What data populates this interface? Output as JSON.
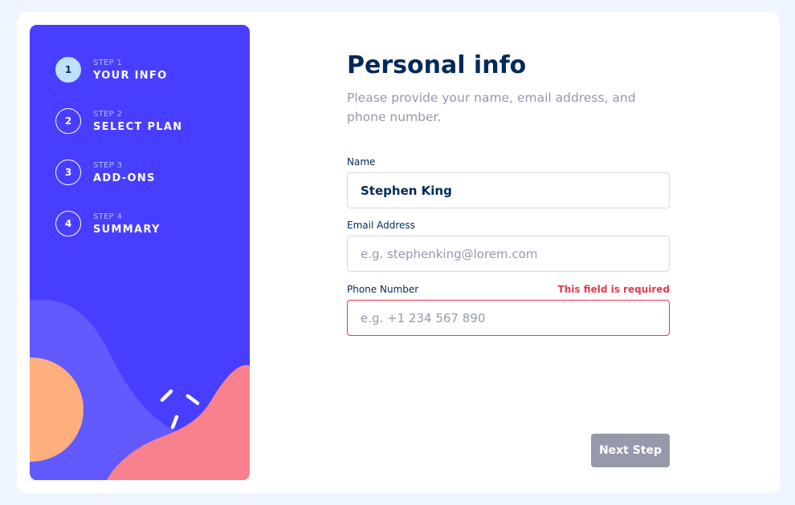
{
  "sidebar": {
    "steps": [
      {
        "number": "1",
        "caption": "STEP 1",
        "title": "YOUR INFO",
        "active": true
      },
      {
        "number": "2",
        "caption": "STEP 2",
        "title": "SELECT PLAN",
        "active": false
      },
      {
        "number": "3",
        "caption": "STEP 3",
        "title": "ADD-ONS",
        "active": false
      },
      {
        "number": "4",
        "caption": "STEP 4",
        "title": "SUMMARY",
        "active": false
      }
    ]
  },
  "form": {
    "title": "Personal info",
    "subtitle": "Please provide your name, email address, and phone number.",
    "name": {
      "label": "Name",
      "value": "Stephen King",
      "placeholder": ""
    },
    "email": {
      "label": "Email Address",
      "value": "",
      "placeholder": "e.g. stephenking@lorem.com"
    },
    "phone": {
      "label": "Phone Number",
      "value": "",
      "placeholder": "e.g. +1 234 567 890",
      "error": "This field is required"
    },
    "next_label": "Next Step"
  },
  "colors": {
    "sidebar_bg": "#483eff",
    "active_step": "#bee2fd",
    "heading": "#022959",
    "muted": "#9699aa",
    "error": "#ee374a",
    "border": "#d6d9e6"
  }
}
